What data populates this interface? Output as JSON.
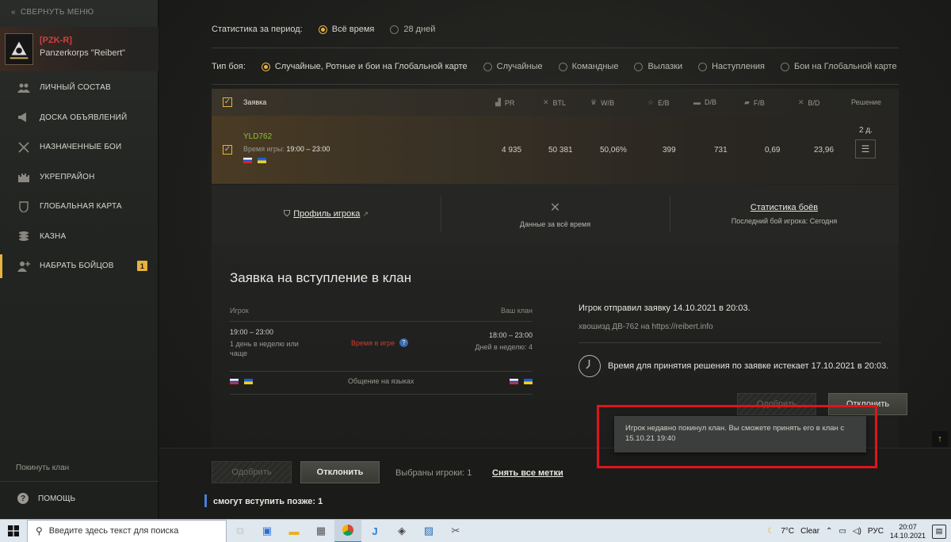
{
  "sidebar": {
    "collapse_label": "СВЕРНУТЬ МЕНЮ",
    "clan_tag": "[PZK-R]",
    "clan_name": "Panzerkorps \"Reibert\"",
    "items": [
      {
        "label": "ЛИЧНЫЙ СОСТАВ",
        "icon": "people-icon"
      },
      {
        "label": "ДОСКА ОБЪЯВЛЕНИЙ",
        "icon": "megaphone-icon"
      },
      {
        "label": "НАЗНАЧЕННЫЕ БОИ",
        "icon": "crossed-swords-icon"
      },
      {
        "label": "УКРЕПРАЙОН",
        "icon": "fortress-icon"
      },
      {
        "label": "ГЛОБАЛЬНАЯ КАРТА",
        "icon": "map-shield-icon"
      },
      {
        "label": "КАЗНА",
        "icon": "coins-icon"
      },
      {
        "label": "НАБРАТЬ БОЙЦОВ",
        "icon": "add-user-icon",
        "badge": "1"
      }
    ],
    "leave_label": "Покинуть клан",
    "help_label": "ПОМОЩЬ"
  },
  "filters": {
    "period_label": "Статистика за период:",
    "period_options": [
      "Всё время",
      "28 дней"
    ],
    "battle_label": "Тип боя:",
    "battle_options": [
      "Случайные, Ротные и бои на Глобальной карте",
      "Случайные",
      "Командные",
      "Вылазки",
      "Наступления",
      "Бои на Глобальной карте"
    ]
  },
  "table": {
    "headers": {
      "request": "Заявка",
      "pr": "PR",
      "btl": "BTL",
      "wb": "W/B",
      "eb": "E/B",
      "db": "D/B",
      "fb": "F/B",
      "bd": "B/D",
      "decision": "Решение"
    },
    "row": {
      "nick": "YLD762",
      "play_time_label": "Время игры:",
      "play_time": "19:00 – 23:00",
      "pr": "4 935",
      "btl": "50 381",
      "wb": "50,06%",
      "eb": "399",
      "db": "731",
      "fb": "0,69",
      "bd": "23,96",
      "days": "2 д."
    }
  },
  "stats_panel": {
    "profile": "Профиль игрока",
    "alltime": "Данные за всё время",
    "battle_stats": "Статистика боёв",
    "last_battle": "Последний бой игрока: Сегодня"
  },
  "application": {
    "title": "Заявка на вступление в клан",
    "player_label": "Игрок",
    "clan_label": "Ваш клан",
    "player_time": "19:00 – 23:00",
    "player_freq": "1 день в неделю или чаще",
    "time_in_game": "Время в игре",
    "clan_time": "18:00 – 23:00",
    "clan_days": "Дней в неделю: 4",
    "languages": "Общение на языках",
    "sent": "Игрок отправил заявку 14.10.2021 в 20:03.",
    "comment": "хвошизд ДВ-762 на https://reibert.info",
    "expires": "Время для принятия решения по заявке истекает 17.10.2021 в 20:03.",
    "approve": "Одобрить",
    "reject": "Отклонить"
  },
  "tooltip": {
    "text": "Игрок недавно покинул клан. Вы сможете принять его в клан с 15.10.21 19:40"
  },
  "bottom": {
    "approve": "Одобрить",
    "reject": "Отклонить",
    "selected": "Выбраны игроки: 1",
    "clear": "Снять все метки",
    "later": "смогут вступить позже: 1"
  },
  "taskbar": {
    "search_placeholder": "Введите здесь текст для поиска",
    "weather": "7°C",
    "weather_text": "Clear",
    "lang": "РУС",
    "time": "20:07",
    "date": "14.10.2021"
  },
  "colors": {
    "accent": "#e8b33b",
    "nick": "#8fbf3a",
    "alert": "#e0141a",
    "time_in_game": "#d03a2a"
  }
}
